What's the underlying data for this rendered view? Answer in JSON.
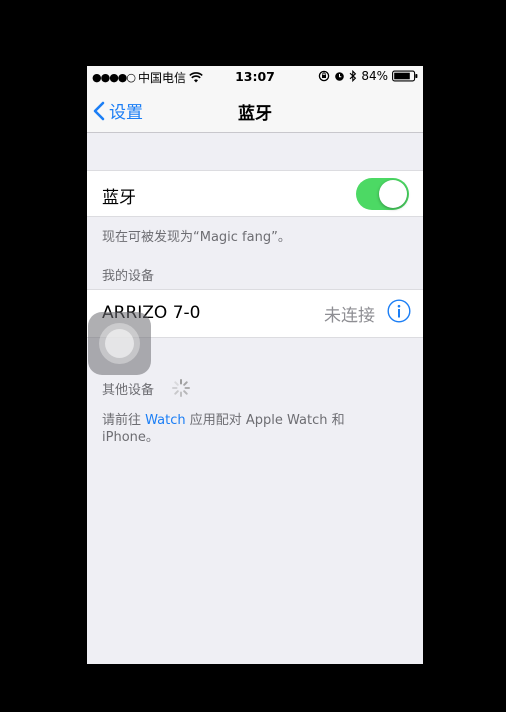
{
  "status_bar": {
    "signal": "●●●●○",
    "carrier": "中国电信",
    "wifi_icon": "wifi-icon",
    "time": "13:07",
    "battery_percent": "84%",
    "battery_level": 0.84
  },
  "nav": {
    "back_label": "设置",
    "title": "蓝牙"
  },
  "bluetooth_row": {
    "label": "蓝牙",
    "toggle_on": true,
    "toggle_color": "#4cd964"
  },
  "discoverable_text": "现在可被发现为“Magic fang”。",
  "my_devices": {
    "header": "我的设备",
    "devices": [
      {
        "name": "ARRIZO 7-0",
        "status": "未连接"
      }
    ]
  },
  "other_devices": {
    "header": "其他设备"
  },
  "watch_note": {
    "prefix": "请前往 ",
    "link": "Watch",
    "suffix": " 应用配对 Apple Watch 和 iPhone。"
  },
  "colors": {
    "accent": "#1b7ef5",
    "background": "#efeff4",
    "secondary_text": "#6d6d72"
  }
}
